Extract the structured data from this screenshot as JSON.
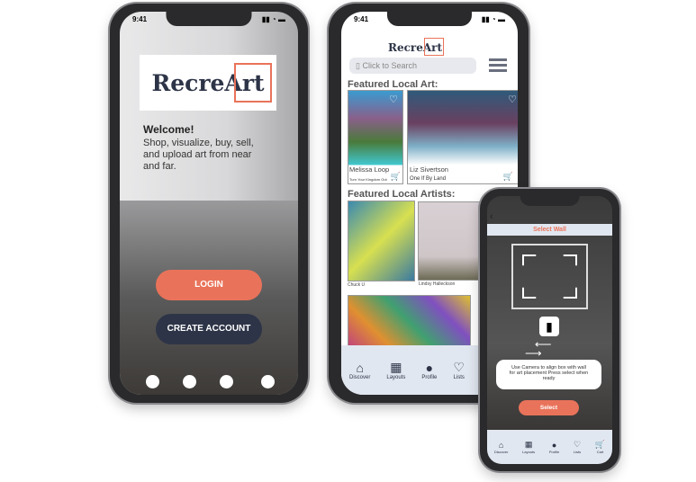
{
  "status_time": "9:41",
  "welcome": {
    "logo": "RecreArt",
    "title": "Welcome!",
    "text": "Shop, visualize, buy, sell, and upload art from near and far.",
    "login": "LOGIN",
    "create": "CREATE ACCOUNT"
  },
  "home": {
    "logo": "RecreArt",
    "search_placeholder": "Click to Search",
    "featured_art": "Featured Local Art:",
    "featured_artists": "Featured Local Artists:",
    "art": [
      {
        "artist": "Melissa Loop",
        "title": "Turn Your Kingdom Out"
      },
      {
        "artist": "Liz Sivertson",
        "title": "One If By Land"
      }
    ],
    "artists": [
      "Chuck U",
      "Lindsy Halleckson"
    ],
    "tabs": [
      "Discover",
      "Layouts",
      "Profile",
      "Lists"
    ]
  },
  "wall": {
    "title": "Select Wall",
    "instructions": "Use Camera to align box with wall for art placement Press select when ready",
    "select": "Select",
    "tabs": [
      "Discover",
      "Layouts",
      "Profile",
      "Lists",
      "Cart"
    ]
  },
  "colors": {
    "accent": "#e9735a",
    "navy": "#2d3447"
  }
}
